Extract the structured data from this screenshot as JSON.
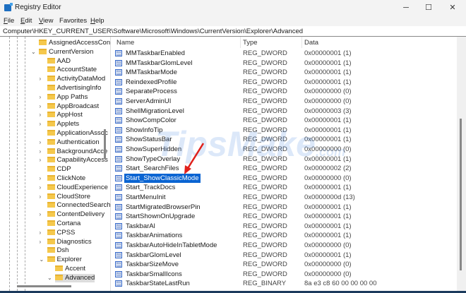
{
  "window": {
    "title": "Registry Editor",
    "minimize": "─",
    "maximize": "☐",
    "close": "✕"
  },
  "menu": [
    {
      "key": "F",
      "rest": "ile"
    },
    {
      "key": "E",
      "rest": "dit"
    },
    {
      "key": "V",
      "rest": "iew"
    },
    {
      "key": "F",
      "rest": "avorites"
    },
    {
      "key": "H",
      "rest": "elp"
    }
  ],
  "address": "Computer\\HKEY_CURRENT_USER\\Software\\Microsoft\\Windows\\CurrentVersion\\Explorer\\Advanced",
  "tree": [
    {
      "label": "AssignedAccessCon",
      "level": 0,
      "chev": ""
    },
    {
      "label": "CurrentVersion",
      "level": 0,
      "chev": "v"
    },
    {
      "label": "AAD",
      "level": 1,
      "chev": ""
    },
    {
      "label": "AccountState",
      "level": 1,
      "chev": ""
    },
    {
      "label": "ActivityDataMod",
      "level": 1,
      "chev": ">"
    },
    {
      "label": "AdvertisingInfo",
      "level": 1,
      "chev": ""
    },
    {
      "label": "App Paths",
      "level": 1,
      "chev": ">"
    },
    {
      "label": "AppBroadcast",
      "level": 1,
      "chev": ">"
    },
    {
      "label": "AppHost",
      "level": 1,
      "chev": ">"
    },
    {
      "label": "Applets",
      "level": 1,
      "chev": ">"
    },
    {
      "label": "ApplicationAssoc",
      "level": 1,
      "chev": ""
    },
    {
      "label": "Authentication",
      "level": 1,
      "chev": ">"
    },
    {
      "label": "BackgroundAcce",
      "level": 1,
      "chev": ">"
    },
    {
      "label": "CapabilityAccess",
      "level": 1,
      "chev": ">"
    },
    {
      "label": "CDP",
      "level": 1,
      "chev": ""
    },
    {
      "label": "ClickNote",
      "level": 1,
      "chev": ">"
    },
    {
      "label": "CloudExperience",
      "level": 1,
      "chev": ">"
    },
    {
      "label": "CloudStore",
      "level": 1,
      "chev": ">"
    },
    {
      "label": "ConnectedSearch",
      "level": 1,
      "chev": ""
    },
    {
      "label": "ContentDelivery",
      "level": 1,
      "chev": ">"
    },
    {
      "label": "Cortana",
      "level": 1,
      "chev": ""
    },
    {
      "label": "CPSS",
      "level": 1,
      "chev": ">"
    },
    {
      "label": "Diagnostics",
      "level": 1,
      "chev": ">"
    },
    {
      "label": "Dsh",
      "level": 1,
      "chev": ""
    },
    {
      "label": "Explorer",
      "level": 1,
      "chev": "v"
    },
    {
      "label": "Accent",
      "level": 2,
      "chev": ""
    },
    {
      "label": "Advanced",
      "level": 2,
      "chev": "v",
      "selected": true
    }
  ],
  "columns": {
    "name": "Name",
    "type": "Type",
    "data": "Data"
  },
  "values": [
    {
      "name": "MMTaskbarEnabled",
      "type": "REG_DWORD",
      "data": "0x00000001 (1)"
    },
    {
      "name": "MMTaskbarGlomLevel",
      "type": "REG_DWORD",
      "data": "0x00000001 (1)"
    },
    {
      "name": "MMTaskbarMode",
      "type": "REG_DWORD",
      "data": "0x00000001 (1)"
    },
    {
      "name": "ReindexedProfile",
      "type": "REG_DWORD",
      "data": "0x00000001 (1)"
    },
    {
      "name": "SeparateProcess",
      "type": "REG_DWORD",
      "data": "0x00000000 (0)"
    },
    {
      "name": "ServerAdminUI",
      "type": "REG_DWORD",
      "data": "0x00000000 (0)"
    },
    {
      "name": "ShellMigrationLevel",
      "type": "REG_DWORD",
      "data": "0x00000003 (3)"
    },
    {
      "name": "ShowCompColor",
      "type": "REG_DWORD",
      "data": "0x00000001 (1)"
    },
    {
      "name": "ShowInfoTip",
      "type": "REG_DWORD",
      "data": "0x00000001 (1)"
    },
    {
      "name": "ShowStatusBar",
      "type": "REG_DWORD",
      "data": "0x00000001 (1)"
    },
    {
      "name": "ShowSuperHidden",
      "type": "REG_DWORD",
      "data": "0x00000000 (0)"
    },
    {
      "name": "ShowTypeOverlay",
      "type": "REG_DWORD",
      "data": "0x00000001 (1)"
    },
    {
      "name": "Start_SearchFiles",
      "type": "REG_DWORD",
      "data": "0x00000002 (2)"
    },
    {
      "name": "Start_ShowClassicMode",
      "type": "REG_DWORD",
      "data": "0x00000000 (0)",
      "selected": true
    },
    {
      "name": "Start_TrackDocs",
      "type": "REG_DWORD",
      "data": "0x00000001 (1)"
    },
    {
      "name": "StartMenuInit",
      "type": "REG_DWORD",
      "data": "0x0000000d (13)"
    },
    {
      "name": "StartMigratedBrowserPin",
      "type": "REG_DWORD",
      "data": "0x00000001 (1)"
    },
    {
      "name": "StartShownOnUpgrade",
      "type": "REG_DWORD",
      "data": "0x00000001 (1)"
    },
    {
      "name": "TaskbarAl",
      "type": "REG_DWORD",
      "data": "0x00000001 (1)"
    },
    {
      "name": "TaskbarAnimations",
      "type": "REG_DWORD",
      "data": "0x00000001 (1)"
    },
    {
      "name": "TaskbarAutoHideInTabletMode",
      "type": "REG_DWORD",
      "data": "0x00000000 (0)"
    },
    {
      "name": "TaskbarGlomLevel",
      "type": "REG_DWORD",
      "data": "0x00000001 (1)"
    },
    {
      "name": "TaskbarSizeMove",
      "type": "REG_DWORD",
      "data": "0x00000000 (0)"
    },
    {
      "name": "TaskbarSmallIcons",
      "type": "REG_DWORD",
      "data": "0x00000000 (0)"
    },
    {
      "name": "TaskbarStateLastRun",
      "type": "REG_BINARY",
      "data": "8a e3 c8 60 00 00 00 00"
    }
  ],
  "watermark": {
    "text": "TipsMake",
    "suffix": ".com"
  },
  "colors": {
    "selection": "#0a64d2",
    "arrow": "#e0201b"
  }
}
